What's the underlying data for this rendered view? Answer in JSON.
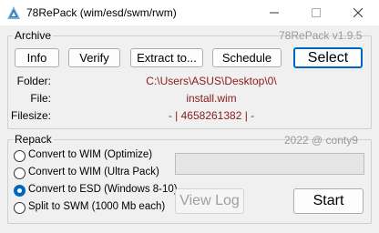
{
  "window": {
    "title": "78RePack (wim/esd/swm/rwm)"
  },
  "archive": {
    "legend": "Archive",
    "version": "78RePack v1.9.5",
    "buttons": {
      "info": "Info",
      "verify": "Verify",
      "extract": "Extract to...",
      "schedule": "Schedule",
      "select": "Select"
    },
    "folder_label": "Folder:",
    "folder_value": "C:\\Users\\ASUS\\Desktop\\0\\",
    "file_label": "File:",
    "file_value": "install.wim",
    "filesize_label": "Filesize:",
    "filesize_value": "- | 4658261382 | -"
  },
  "repack": {
    "legend": "Repack",
    "credit": "2022 @ conty9",
    "options": [
      {
        "label": "Convert to WIM (Optimize)",
        "checked": false
      },
      {
        "label": "Convert to WIM (Ultra Pack)",
        "checked": false
      },
      {
        "label": "Convert to ESD (Windows 8-10)",
        "checked": true
      },
      {
        "label": "Split to SWM (1000 Mb each)",
        "checked": false
      }
    ],
    "progress": 0,
    "view_log": "View Log",
    "start": "Start"
  },
  "colors": {
    "accent": "#0067c0",
    "value_text": "#8b1a1a",
    "muted_text": "#9a9a9a"
  }
}
